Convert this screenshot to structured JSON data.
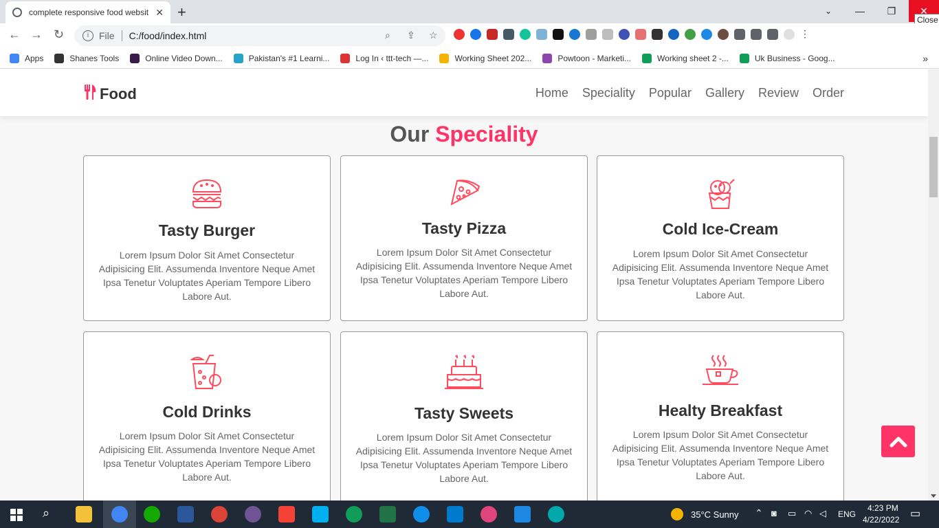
{
  "browser": {
    "tab_title": "complete responsive food websit",
    "tab_close": "✕",
    "new_tab": "+",
    "window_minimize": "—",
    "window_restore": "❐",
    "window_close": "✕",
    "tooltip": "Close",
    "url_scheme_label": "File",
    "url": "C:/food/index.html",
    "bookmarks": [
      {
        "label": "Apps",
        "color": "#4285f4"
      },
      {
        "label": "Shanes Tools",
        "color": "#333333"
      },
      {
        "label": "Online Video Down...",
        "color": "#3a1a4a"
      },
      {
        "label": "Pakistan's #1 Learni...",
        "color": "#2aa3c9"
      },
      {
        "label": "Log In ‹ ttt-tech —...",
        "color": "#d33"
      },
      {
        "label": "Working Sheet 202...",
        "color": "#f4b400"
      },
      {
        "label": "Powtoon - Marketi...",
        "color": "#8e44ad"
      },
      {
        "label": "Working sheet 2 -...",
        "color": "#0f9d58"
      },
      {
        "label": "Uk Business - Goog...",
        "color": "#0f9d58"
      }
    ],
    "bookmarks_more": "»"
  },
  "site": {
    "logo_icon": "utensils-icon",
    "logo_text": "Food",
    "nav": [
      "Home",
      "Speciality",
      "Popular",
      "Gallery",
      "Review",
      "Order"
    ],
    "heading_prefix": "Our",
    "heading_accent": "Speciality",
    "accent_color": "#ff3366",
    "cards": [
      {
        "title": "Tasty Burger",
        "icon": "burger-icon",
        "text": "Lorem Ipsum Dolor Sit Amet Consectetur Adipisicing Elit. Assumenda Inventore Neque Amet Ipsa Tenetur Voluptates Aperiam Tempore Libero Labore Aut."
      },
      {
        "title": "Tasty Pizza",
        "icon": "pizza-icon",
        "text": "Lorem Ipsum Dolor Sit Amet Consectetur Adipisicing Elit. Assumenda Inventore Neque Amet Ipsa Tenetur Voluptates Aperiam Tempore Libero Labore Aut."
      },
      {
        "title": "Cold Ice-Cream",
        "icon": "ice-cream-icon",
        "text": "Lorem Ipsum Dolor Sit Amet Consectetur Adipisicing Elit. Assumenda Inventore Neque Amet Ipsa Tenetur Voluptates Aperiam Tempore Libero Labore Aut."
      },
      {
        "title": "Cold Drinks",
        "icon": "drink-icon",
        "text": "Lorem Ipsum Dolor Sit Amet Consectetur Adipisicing Elit. Assumenda Inventore Neque Amet Ipsa Tenetur Voluptates Aperiam Tempore Libero Labore Aut."
      },
      {
        "title": "Tasty Sweets",
        "icon": "cake-icon",
        "text": "Lorem Ipsum Dolor Sit Amet Consectetur Adipisicing Elit. Assumenda Inventore Neque Amet Ipsa Tenetur Voluptates Aperiam Tempore Libero Labore Aut."
      },
      {
        "title": "Healty Breakfast",
        "icon": "coffee-cup-icon",
        "text": "Lorem Ipsum Dolor Sit Amet Consectetur Adipisicing Elit. Assumenda Inventore Neque Amet Ipsa Tenetur Voluptates Aperiam Tempore Libero Labore Aut."
      }
    ]
  },
  "taskbar": {
    "weather": "35°C  Sunny",
    "language": "ENG",
    "time": "4:23 PM",
    "date": "4/22/2022"
  }
}
